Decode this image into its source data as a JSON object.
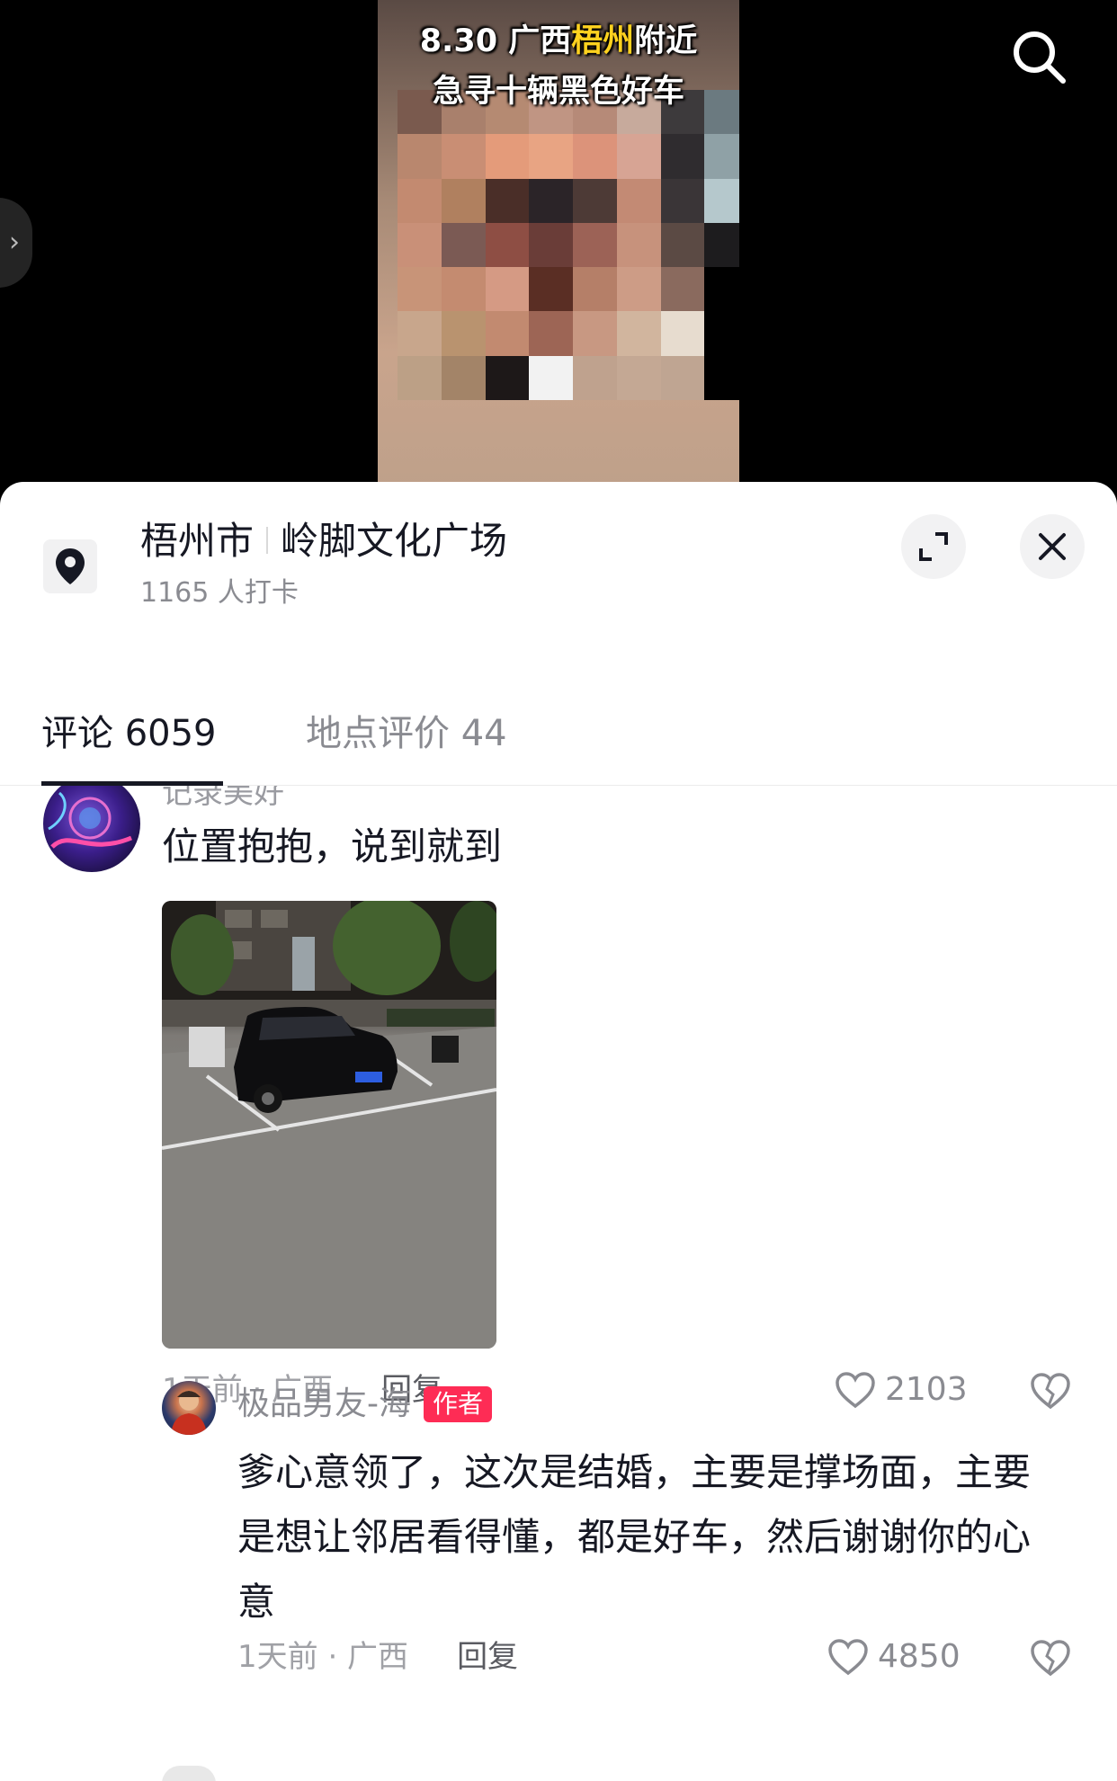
{
  "video": {
    "title_line1_prefix": "8.30 广西",
    "title_line1_highlight": "梧州",
    "title_line1_suffix": "附近",
    "title_line2": "急寻十辆黑色好车"
  },
  "location": {
    "city": "梧州市",
    "place": "岭脚文化广场",
    "checkins": "1165 人打卡"
  },
  "tabs": [
    {
      "label": "评论 6059",
      "active": true
    },
    {
      "label": "地点评价 44",
      "active": false
    }
  ],
  "comments": [
    {
      "username": "记录美好",
      "text": "位置抱抱，说到就到",
      "time": "1天前 · 广西",
      "reply_label": "回复",
      "likes": "2103"
    },
    {
      "username": "极品男友-海",
      "badge": "作者",
      "text": "爹心意领了，这次是结婚，主要是撑场面，主要是想让邻居看得懂，都是好车，然后谢谢你的心意",
      "time": "1天前 · 广西",
      "reply_label": "回复",
      "likes": "4850"
    }
  ],
  "colors": {
    "accent": "#fe2c55",
    "highlight": "#ffd21f",
    "text_primary": "#161823",
    "text_secondary": "#8a8b91"
  },
  "icons": [
    "search-icon",
    "location-pin-icon",
    "expand-icon",
    "close-icon",
    "heart-icon",
    "broken-heart-icon",
    "chevron-right-icon"
  ]
}
